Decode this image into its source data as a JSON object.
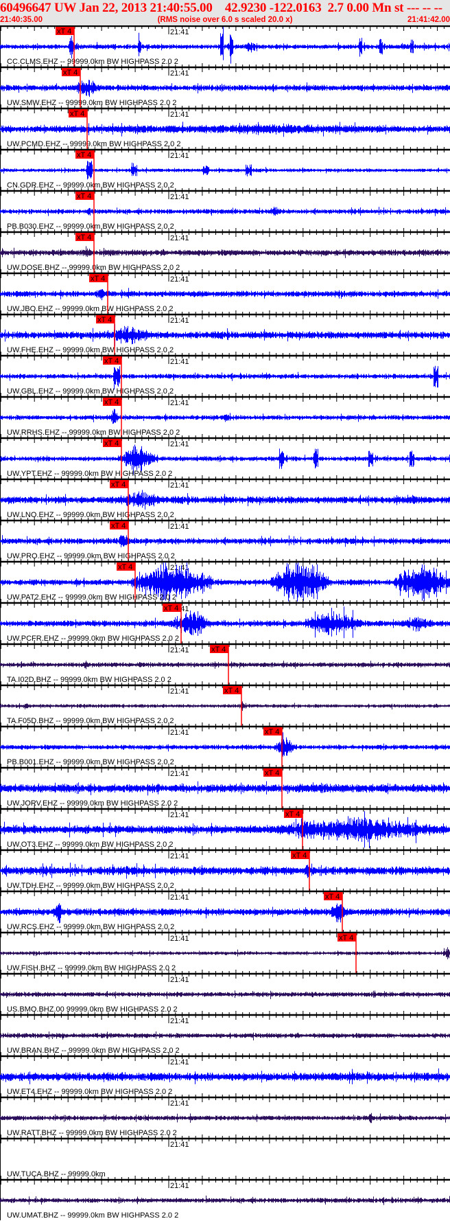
{
  "header": {
    "title": "60496647 UW Jan 22, 2013 21:40:55.00    42.9230 -122.0163  2.7 0.00 Mn st --- -- --   -1",
    "start_time": "21:40:35.00",
    "note": "(RMS noise over 6.0 s scaled 20.0 x)",
    "end_time": "21:41:42.00"
  },
  "colors": {
    "ehz": "#0000ff",
    "bhz": "#2b0f5c",
    "pick": "#ff0000",
    "header_bg": "#e6e6e6",
    "header_text": "#ff0000"
  },
  "chart_data": {
    "type": "line",
    "title": "60496647 UW Jan 22, 2013 21:40:55.00    42.9230 -122.0163  2.7 0.00 Mn st --- -- --   -1",
    "x_range": [
      "21:40:35.00",
      "21:41:42.00"
    ],
    "time_tick_label": "21:41",
    "pick_label": "xT 4",
    "traces": [
      {
        "label": "CC.CLMS.EHZ -- 99999.0km BW  HIGHPASS  2.0  2",
        "component": "EHZ",
        "pick": true
      },
      {
        "label": "UW.SMW.EHZ -- 99999.0km BW  HIGHPASS  2.0  2",
        "component": "EHZ",
        "pick": true
      },
      {
        "label": "UW.PCMD.EHZ -- 99999.0km BW  HIGHPASS  2.0  2",
        "component": "EHZ",
        "pick": true
      },
      {
        "label": "CN.GDR.EHZ -- 99999.0km BW  HIGHPASS  2.0  2",
        "component": "EHZ",
        "pick": true
      },
      {
        "label": "PB.B030.EHZ -- 99999.0km BW  HIGHPASS  2.0  2",
        "component": "EHZ",
        "pick": true
      },
      {
        "label": "UW.DOSE.BHZ -- 99999.0km BW  HIGHPASS  2.0  2",
        "component": "BHZ",
        "pick": true
      },
      {
        "label": "UW.JBO.EHZ -- 99999.0km BW  HIGHPASS  2.0  2",
        "component": "EHZ",
        "pick": true
      },
      {
        "label": "UW.FHE.EHZ -- 99999.0km BW  HIGHPASS  2.0  2",
        "component": "EHZ",
        "pick": true
      },
      {
        "label": "UW.GBL.EHZ -- 99999.0km BW  HIGHPASS  2.0  2",
        "component": "EHZ",
        "pick": true
      },
      {
        "label": "UW.RRHS.EHZ -- 99999.0km BW  HIGHPASS  2.0  2",
        "component": "EHZ",
        "pick": true
      },
      {
        "label": "UW.YPT.EHZ -- 99999.0km BW  HIGHPASS  2.0  2",
        "component": "EHZ",
        "pick": true
      },
      {
        "label": "UW.LNO.EHZ -- 99999.0km BW  HIGHPASS  2.0  2",
        "component": "EHZ",
        "pick": true
      },
      {
        "label": "UW.PRO.EHZ -- 99999.0km BW  HIGHPASS  2.0  2",
        "component": "EHZ",
        "pick": true
      },
      {
        "label": "UW.PAT2.EHZ -- 99999.0km BW  HIGHPASS  2.0  2",
        "component": "EHZ",
        "pick": true
      },
      {
        "label": "UW.PCFR.EHZ -- 99999.0km BW  HIGHPASS  2.0  2",
        "component": "EHZ",
        "pick": true
      },
      {
        "label": "TA.I02D.BHZ -- 99999.0km BW  HIGHPASS  2.0  2",
        "component": "BHZ",
        "pick": true
      },
      {
        "label": "TA.F05D.BHZ -- 99999.0km BW  HIGHPASS  2.0  2",
        "component": "BHZ",
        "pick": true
      },
      {
        "label": "PB.B001.EHZ -- 99999.0km BW  HIGHPASS  2.0  2",
        "component": "EHZ",
        "pick": true
      },
      {
        "label": "UW.JORV.EHZ -- 99999.0km BW  HIGHPASS  2.0  2",
        "component": "EHZ",
        "pick": true
      },
      {
        "label": "UW.OT3.EHZ -- 99999.0km BW  HIGHPASS  2.0  2",
        "component": "EHZ",
        "pick": true
      },
      {
        "label": "UW.TDH.EHZ -- 99999.0km BW  HIGHPASS  2.0  2",
        "component": "EHZ",
        "pick": true
      },
      {
        "label": "UW.RCS.EHZ -- 99999.0km BW  HIGHPASS  2.0  2",
        "component": "EHZ",
        "pick": true
      },
      {
        "label": "UW.FISH.BHZ -- 99999.0km BW  HIGHPASS  2.0  2",
        "component": "BHZ",
        "pick": true
      },
      {
        "label": "US.BMO.BHZ.00 99999.0km BW  HIGHPASS  2.0  2",
        "component": "BHZ",
        "pick": false
      },
      {
        "label": "UW.BRAN.BHZ -- 99999.0km BW  HIGHPASS  2.0  2",
        "component": "BHZ",
        "pick": false
      },
      {
        "label": "UW.ET4.EHZ -- 99999.0km BW  HIGHPASS  2.0  2",
        "component": "EHZ",
        "pick": false
      },
      {
        "label": "UW.RATT.BHZ -- 99999.0km BW  HIGHPASS  2.0  2",
        "component": "BHZ",
        "pick": false
      },
      {
        "label": "UW.TUCA.BHZ -- 99999.0km",
        "component": "BHZ",
        "pick": false
      },
      {
        "label": "UW.UMAT.BHZ -- 99999.0km BW  HIGHPASS  2.0  2",
        "component": "BHZ",
        "pick": false
      }
    ]
  }
}
